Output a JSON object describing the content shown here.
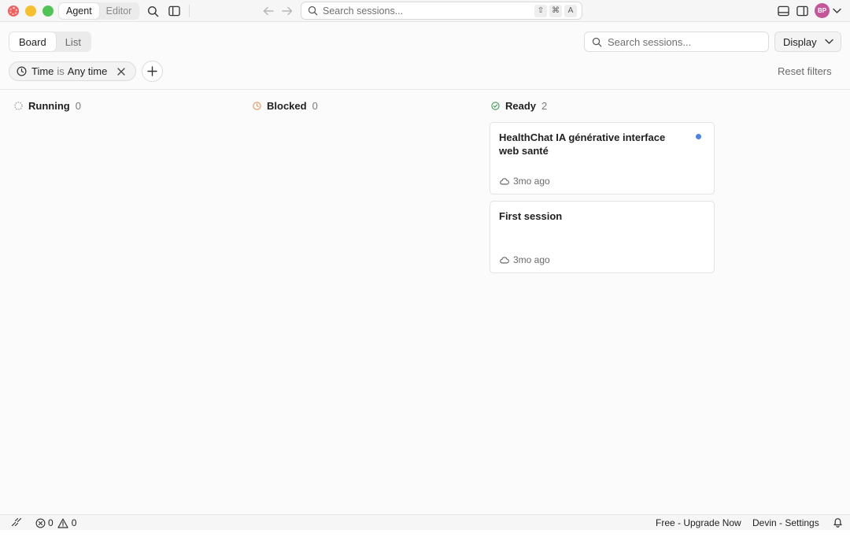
{
  "titlebar": {
    "tabs": [
      {
        "label": "Agent",
        "active": true
      },
      {
        "label": "Editor",
        "active": false
      }
    ],
    "search_placeholder": "Search sessions...",
    "shortcut_keys": [
      "⇧",
      "⌘",
      "A"
    ],
    "avatar_initials": "BP"
  },
  "toolbar": {
    "views": [
      {
        "label": "Board",
        "active": true
      },
      {
        "label": "List",
        "active": false
      }
    ],
    "search_placeholder": "Search sessions...",
    "display_label": "Display",
    "filter": {
      "field": "Time",
      "operator": "is",
      "value": "Any time"
    },
    "reset_label": "Reset filters"
  },
  "columns": [
    {
      "name": "Running",
      "count": "0",
      "status_color": "#8a8a8a"
    },
    {
      "name": "Blocked",
      "count": "0",
      "status_color": "#e8915a"
    },
    {
      "name": "Ready",
      "count": "2",
      "status_color": "#3f9a55"
    }
  ],
  "cards": [
    {
      "title": "HealthChat IA générative interface web santé",
      "time": "3mo ago",
      "unread": true
    },
    {
      "title": "First session",
      "time": "3mo ago",
      "unread": false
    }
  ],
  "statusbar": {
    "errors": "0",
    "warnings": "0",
    "upgrade": "Free - Upgrade Now",
    "settings": "Devin - Settings"
  },
  "colors": {
    "accent_dot": "#4f82e8",
    "avatar": "#c5569a"
  }
}
